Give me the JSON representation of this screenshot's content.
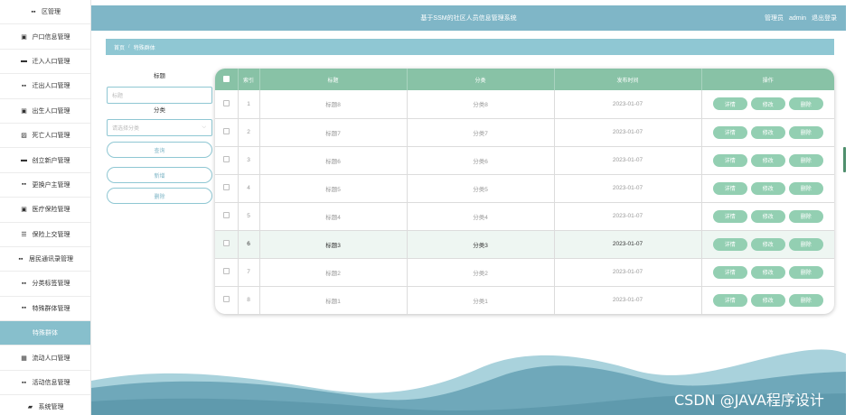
{
  "sidebar": {
    "items": [
      {
        "label": "区管理",
        "icon": "grid-icon",
        "glyph": "▪▪",
        "active": false
      },
      {
        "label": "户口信息管理",
        "icon": "clipboard-icon",
        "glyph": "▣",
        "active": false
      },
      {
        "label": "迁入人口管理",
        "icon": "monitor-icon",
        "glyph": "▬",
        "active": false
      },
      {
        "label": "迁出人口管理",
        "icon": "grid-icon",
        "glyph": "▪▪",
        "active": false
      },
      {
        "label": "出生人口管理",
        "icon": "clipboard-icon",
        "glyph": "▣",
        "active": false
      },
      {
        "label": "死亡人口管理",
        "icon": "checkbox-icon",
        "glyph": "▨",
        "active": false
      },
      {
        "label": "创立新户管理",
        "icon": "monitor-icon",
        "glyph": "▬",
        "active": false
      },
      {
        "label": "更换户主管理",
        "icon": "grid-icon",
        "glyph": "▪▪",
        "active": false
      },
      {
        "label": "医疗保险管理",
        "icon": "clipboard-icon",
        "glyph": "▣",
        "active": false
      },
      {
        "label": "保险上交管理",
        "icon": "list-icon",
        "glyph": "☰",
        "active": false
      },
      {
        "label": "居民通讯录管理",
        "icon": "grid-icon",
        "glyph": "▪▪",
        "active": false
      },
      {
        "label": "分类标签管理",
        "icon": "grid-icon",
        "glyph": "▪▪",
        "active": false
      },
      {
        "label": "特殊群体管理",
        "icon": "grid-icon",
        "glyph": "▪▪",
        "active": false
      },
      {
        "label": "特殊群体",
        "icon": "",
        "glyph": "",
        "active": true
      },
      {
        "label": "流动人口管理",
        "icon": "table-icon",
        "glyph": "▦",
        "active": false
      },
      {
        "label": "活动信息管理",
        "icon": "grid-icon",
        "glyph": "▪▪",
        "active": false
      },
      {
        "label": "系统管理",
        "icon": "briefcase-icon",
        "glyph": "▰",
        "active": false
      }
    ]
  },
  "header": {
    "title": "基于SSM的社区人员信息管理系统",
    "user_role": "管理员",
    "username": "admin",
    "logout": "退出登录"
  },
  "breadcrumb": {
    "home": "首页",
    "separator": "/",
    "current": "特殊群体"
  },
  "search": {
    "title_label": "标题",
    "title_placeholder": "标题",
    "category_label": "分类",
    "category_placeholder": "请选择分类",
    "query_button": "查询",
    "add_button": "新增",
    "delete_button": "删除"
  },
  "table": {
    "columns": [
      "索引",
      "标题",
      "分类",
      "发布时间",
      "操作"
    ],
    "action_labels": {
      "detail": "详情",
      "edit": "修改",
      "delete": "删除"
    },
    "rows": [
      {
        "index": "1",
        "title": "标题8",
        "category": "分类8",
        "date": "2023-01-07"
      },
      {
        "index": "2",
        "title": "标题7",
        "category": "分类7",
        "date": "2023-01-07"
      },
      {
        "index": "3",
        "title": "标题6",
        "category": "分类6",
        "date": "2023-01-07"
      },
      {
        "index": "4",
        "title": "标题5",
        "category": "分类5",
        "date": "2023-01-07"
      },
      {
        "index": "5",
        "title": "标题4",
        "category": "分类4",
        "date": "2023-01-07"
      },
      {
        "index": "6",
        "title": "标题3",
        "category": "分类3",
        "date": "2023-01-07",
        "highlighted": true
      },
      {
        "index": "7",
        "title": "标题2",
        "category": "分类2",
        "date": "2023-01-07"
      },
      {
        "index": "8",
        "title": "标题1",
        "category": "分类1",
        "date": "2023-01-07"
      }
    ]
  },
  "watermark": "CSDN @JAVA程序设计",
  "colors": {
    "accent": "#7fb6c7",
    "table_header": "#88c2a6",
    "action_button": "#93cfb2",
    "active_sidebar": "#87bfcc"
  }
}
